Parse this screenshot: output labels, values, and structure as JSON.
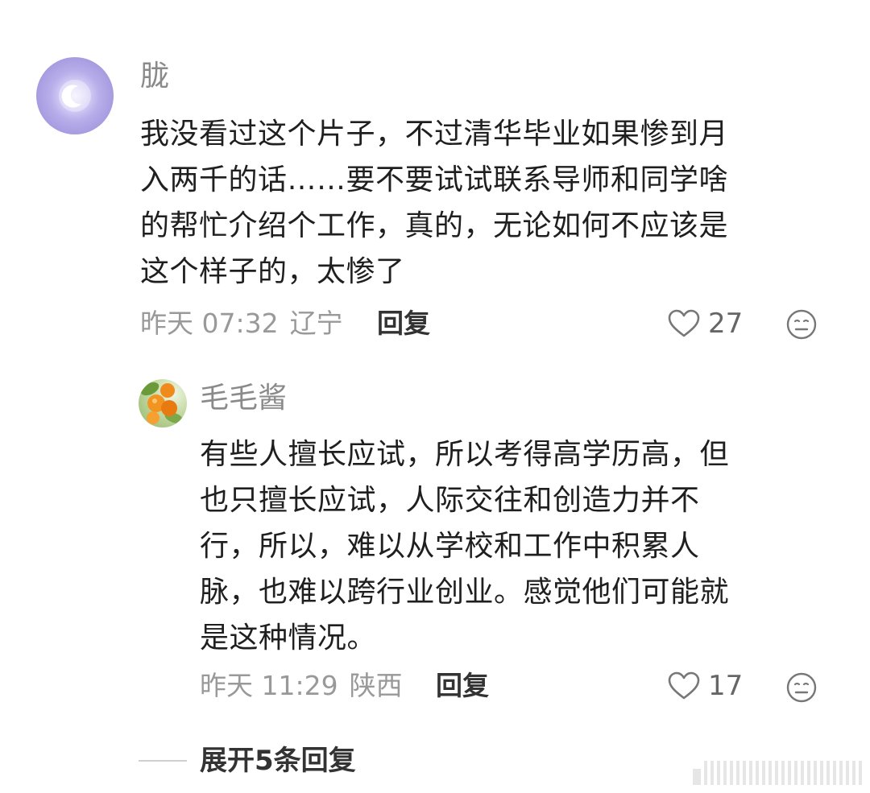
{
  "comment": {
    "author": "胧",
    "content_lines": [
      "我没看过这个片子，不过清华毕业如果惨到月",
      "入两千的话……要不要试试联系导师和同学啥",
      "的帮忙介绍个工作，真的，无论如何不应该是",
      "这个样子的，太惨了"
    ],
    "time": "昨天 07:32",
    "location": "辽宁",
    "reply_label": "回复",
    "like_count": "27",
    "avatar_icon": "crescent-moon-avatar"
  },
  "reply": {
    "author": "毛毛酱",
    "content_lines": [
      "有些人擅长应试，所以考得高学历高，但",
      "也只擅长应试，人际交往和创造力并不",
      "行，所以，难以从学校和工作中积累人",
      "脉，也难以跨行业创业。感觉他们可能就",
      "是这种情况。"
    ],
    "time": "昨天 11:29",
    "location": "陕西",
    "reply_label": "回复",
    "like_count": "17",
    "avatar_icon": "orange-fruit-avatar"
  },
  "expand_label": "展开5条回复",
  "icons": {
    "like": "heart-outline-icon",
    "dislike": "meh-face-icon"
  },
  "colors": {
    "author": "#8a8a8a",
    "meta": "#999999",
    "body_text": "#1f1f1f",
    "avatar_main": "#a79ce0",
    "avatar_sub": "#8fb668"
  }
}
